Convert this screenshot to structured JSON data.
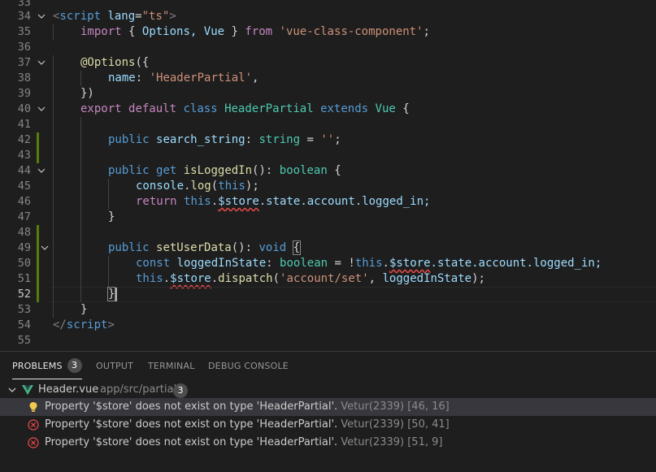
{
  "editor": {
    "lines": [
      {
        "n": "33"
      },
      {
        "n": "34",
        "fold": "down"
      },
      {
        "n": "35"
      },
      {
        "n": "36"
      },
      {
        "n": "37",
        "fold": "down"
      },
      {
        "n": "38"
      },
      {
        "n": "39"
      },
      {
        "n": "40",
        "fold": "down"
      },
      {
        "n": "41"
      },
      {
        "n": "42",
        "changed": true
      },
      {
        "n": "43",
        "changed": true
      },
      {
        "n": "44",
        "fold": "down"
      },
      {
        "n": "45"
      },
      {
        "n": "46"
      },
      {
        "n": "47"
      },
      {
        "n": "48",
        "changed": true
      },
      {
        "n": "49",
        "changed": true,
        "fold": "down"
      },
      {
        "n": "50",
        "changed": true
      },
      {
        "n": "51",
        "changed": true
      },
      {
        "n": "52",
        "changed": true
      },
      {
        "n": "53"
      },
      {
        "n": "54"
      },
      {
        "n": "55"
      }
    ],
    "code": {
      "l34": {
        "open": "<",
        "tag": "script",
        "attr": "lang",
        "eq": "=",
        "val": "\"ts\"",
        "close": ">"
      },
      "l35": {
        "import": "import",
        "lb": "{",
        "names": "Options,",
        "vue": "Vue",
        "rb": "}",
        "from": "from",
        "module": "'vue-class-component'",
        "semi": ";"
      },
      "l37": {
        "decorator": "@Options",
        "paren": "({"
      },
      "l38": {
        "key": "name",
        "colon": ":",
        "val": "'HeaderPartial'",
        "comma": ","
      },
      "l39": {
        "close": "})"
      },
      "l40": {
        "export": "export",
        "default": "default",
        "class": "class",
        "name": "HeaderPartial",
        "extends": "extends",
        "base": "Vue",
        "brace": "{"
      },
      "l42": {
        "public": "public",
        "prop": "search_string",
        "colon": ":",
        "type": "string",
        "eq": "=",
        "val": "''",
        "semi": ";"
      },
      "l44": {
        "public": "public",
        "get": "get",
        "fn": "isLoggedIn",
        "parens": "():",
        "type": "boolean",
        "brace": "{"
      },
      "l45": {
        "obj": "console",
        "dot": ".",
        "fn": "log",
        "lp": "(",
        "this": "this",
        "rp": ");"
      },
      "l46": {
        "ret": "return",
        "this": "this",
        "dot1": ".",
        "store": "$store",
        "rest": ".state.account.logged_in;"
      },
      "l47": {
        "brace": "}"
      },
      "l49": {
        "public": "public",
        "fn": "setUserData",
        "parens": "():",
        "type": "void",
        "brace": "{"
      },
      "l50": {
        "const": "const",
        "var": "loggedInState",
        "colon": ":",
        "type": "boolean",
        "eq": "=",
        "bang": "!",
        "this": "this",
        "dot1": ".",
        "store": "$store",
        "rest": ".state.account.logged_in;"
      },
      "l51": {
        "this": "this",
        "dot1": ".",
        "store": "$store",
        "dot2": ".",
        "fn": "dispatch",
        "lp": "(",
        "arg": "'account/set'",
        "comma": ",",
        "var": "loggedInState",
        "rp": ");"
      },
      "l52": {
        "brace": "}"
      },
      "l53": {
        "brace": "}"
      },
      "l54": {
        "open": "</",
        "tag": "script",
        "close": ">"
      }
    }
  },
  "panel": {
    "tabs": [
      {
        "label": "PROBLEMS",
        "badge": "3",
        "active": true
      },
      {
        "label": "OUTPUT"
      },
      {
        "label": "TERMINAL"
      },
      {
        "label": "DEBUG CONSOLE"
      }
    ],
    "file": {
      "name": "Header.vue",
      "path": "app/src/partials",
      "count": "3"
    },
    "problems": [
      {
        "severity": "hint",
        "icon": "lightbulb-icon",
        "message": "Property '$store' does not exist on type 'HeaderPartial'.",
        "source": "Vetur(2339)",
        "pos": "[46, 16]"
      },
      {
        "severity": "error",
        "icon": "error-icon",
        "message": "Property '$store' does not exist on type 'HeaderPartial'.",
        "source": "Vetur(2339)",
        "pos": "[50, 41]"
      },
      {
        "severity": "error",
        "icon": "error-icon",
        "message": "Property '$store' does not exist on type 'HeaderPartial'.",
        "source": "Vetur(2339)",
        "pos": "[51, 9]"
      }
    ]
  },
  "colors": {
    "vue_green": "#41b883",
    "git_modified": "#587c0c",
    "error": "#f14c4c",
    "hint": "#f2c94c"
  }
}
